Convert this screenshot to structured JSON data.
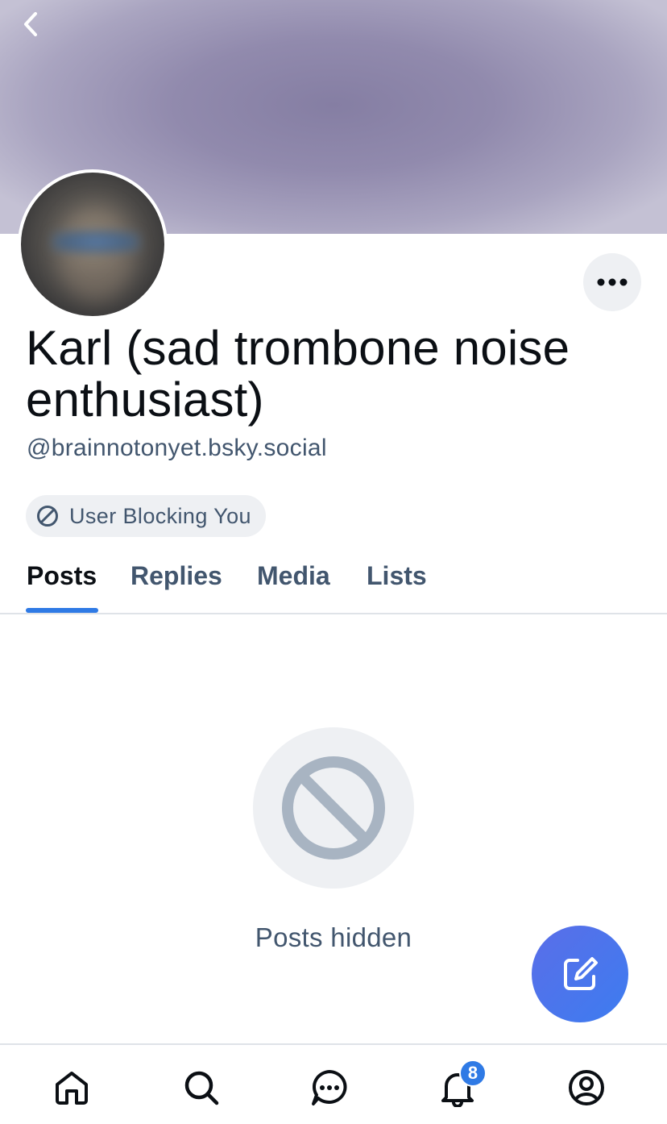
{
  "profile": {
    "display_name": "Karl (sad trombone noise enthusiast)",
    "handle": "@brainnotonyet.bsky.social",
    "blocking_label": "User Blocking You"
  },
  "tabs": [
    {
      "label": "Posts",
      "active": true
    },
    {
      "label": "Replies",
      "active": false
    },
    {
      "label": "Media",
      "active": false
    },
    {
      "label": "Lists",
      "active": false
    }
  ],
  "feed": {
    "empty_message": "Posts hidden",
    "empty_icon": "block-icon"
  },
  "nav": {
    "items": [
      "home-icon",
      "search-icon",
      "chat-icon",
      "bell-icon",
      "profile-icon"
    ],
    "notifications_badge": "8"
  },
  "icons": {
    "back": "chevron-left-icon",
    "more": "ellipsis-icon",
    "compose": "compose-icon",
    "blocking": "block-icon"
  },
  "colors": {
    "accent": "#2f7ae5",
    "muted_text": "#42566e",
    "pill_bg": "#eef0f3"
  }
}
